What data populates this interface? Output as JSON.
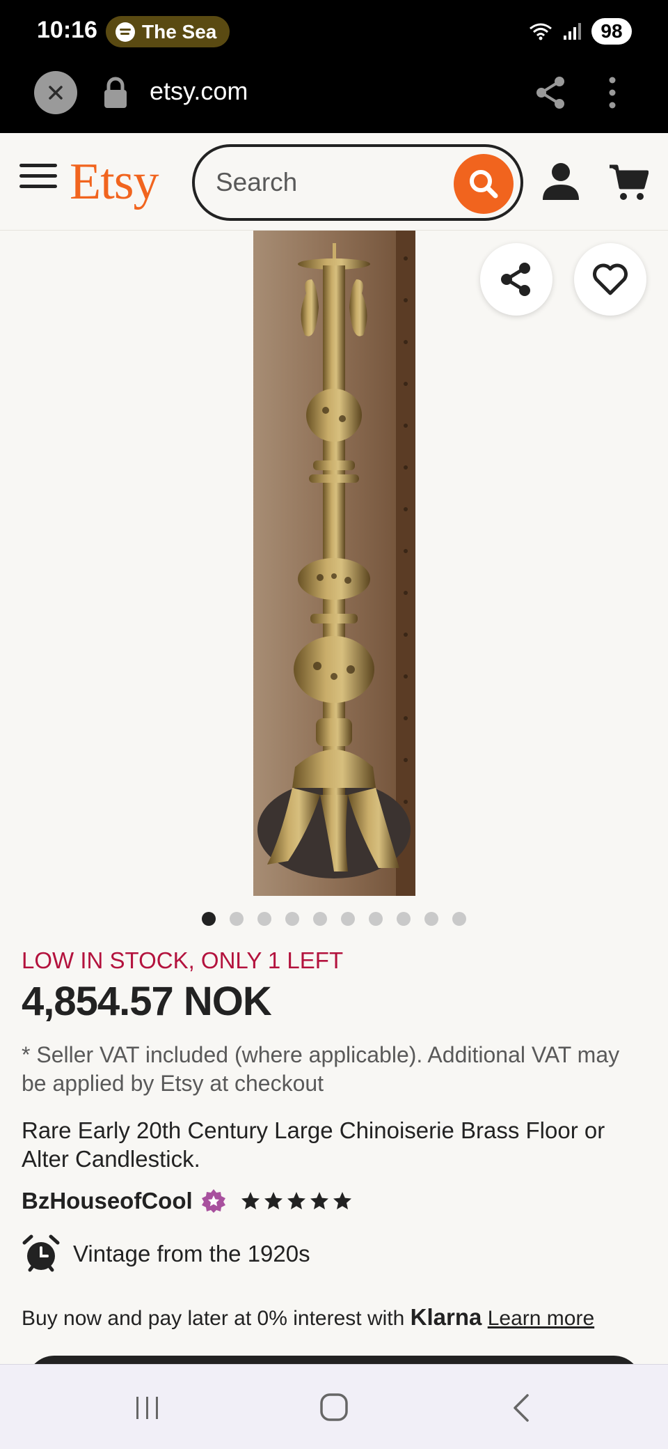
{
  "status_bar": {
    "time": "10:16",
    "media_title": "The Sea",
    "battery": "98"
  },
  "browser": {
    "url": "etsy.com"
  },
  "header": {
    "logo": "Etsy",
    "search_placeholder": "Search",
    "accent_color": "#f1641e"
  },
  "gallery": {
    "image_count": 10,
    "active_index": 0
  },
  "product": {
    "stock_notice": "LOW IN STOCK, ONLY 1 LEFT",
    "price": "4,854.57 NOK",
    "vat_note": "* Seller VAT included (where applicable). Additional VAT may be applied by Etsy at checkout",
    "title": "Rare Early 20th Century Large Chinoiserie Brass Floor or Alter Candlestick.",
    "shop_name": "BzHouseofCool",
    "rating_stars": 5,
    "vintage_label": "Vintage from the 1920s"
  },
  "klarna": {
    "text": "Buy now and pay later at 0% interest with",
    "brand": "Klarna",
    "link": "Learn more"
  }
}
